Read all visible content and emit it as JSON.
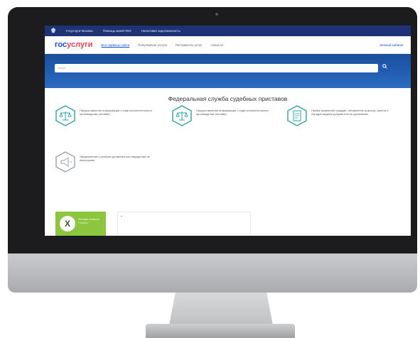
{
  "topbar": {
    "flag_icon": "emblem-icon",
    "links": [
      "Госуслуги Москвы",
      "Помощь моей НКО",
      "Налоговая задолженность"
    ]
  },
  "nav": {
    "logo": {
      "part1": "гос",
      "part2": "услуги"
    },
    "links": [
      "Все сервисы сайта",
      "Популярные услуги",
      "Регламенты услуг",
      "Новости"
    ],
    "login": "Личный кабинет"
  },
  "search": {
    "placeholder": "Поиск"
  },
  "page": {
    "title": "Федеральная служба судебных приставов"
  },
  "services": [
    {
      "icon": "scales-icon",
      "text": "Предоставление информации о ходе исполнительного производства (онлайн)"
    },
    {
      "icon": "scales-icon",
      "text": "Предоставление информации о ходе исполнительного производства (онлайн)"
    },
    {
      "icon": "document-icon",
      "text": "Приём заявлений граждан, объявление розыска, ареста и порядок выдачи документов по должникам"
    },
    {
      "icon": "megaphone-icon",
      "text": "Уведомление о розыске должника или имущества по категориям"
    }
  ],
  "ad": {
    "letter": "X",
    "text": "Реклама сервисов Госуслуг"
  },
  "colors": {
    "brand_blue": "#0d4cd3",
    "brand_red": "#ee3f58",
    "topbar": "#1e3275",
    "banner": "#2a6bc1",
    "icon_teal": "#2aa3a6"
  }
}
